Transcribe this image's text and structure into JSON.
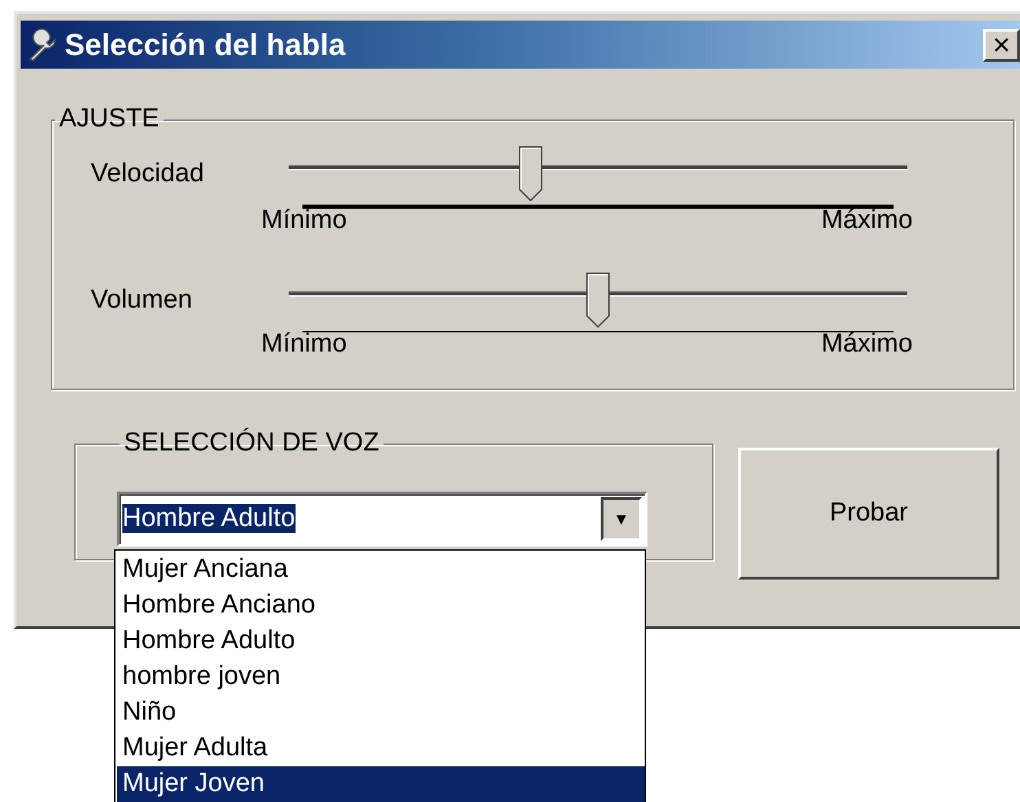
{
  "window": {
    "title": "Selección del habla",
    "close": "×"
  },
  "adjust": {
    "legend": "AJUSTE",
    "sliders": [
      {
        "label": "Velocidad",
        "level": 0.39,
        "focused": true,
        "min_label": "Mínimo",
        "max_label": "Máximo"
      },
      {
        "label": "Volumen",
        "level": 0.5,
        "focused": false,
        "min_label": "Mínimo",
        "max_label": "Máximo"
      }
    ]
  },
  "voice": {
    "legend": "SELECCIÓN DE VOZ",
    "combo": {
      "value": "Hombre Adulto",
      "arrow": "▼",
      "expanded": true
    },
    "options": [
      {
        "label": "Mujer Anciana",
        "selected": false
      },
      {
        "label": "Hombre Anciano",
        "selected": false
      },
      {
        "label": "Hombre Adulto",
        "selected": false
      },
      {
        "label": "hombre joven",
        "selected": false
      },
      {
        "label": "Niño",
        "selected": false
      },
      {
        "label": "Mujer Adulta",
        "selected": false
      },
      {
        "label": "Mujer Joven",
        "selected": true
      }
    ]
  },
  "buttons": [
    {
      "label": "Probar"
    }
  ]
}
